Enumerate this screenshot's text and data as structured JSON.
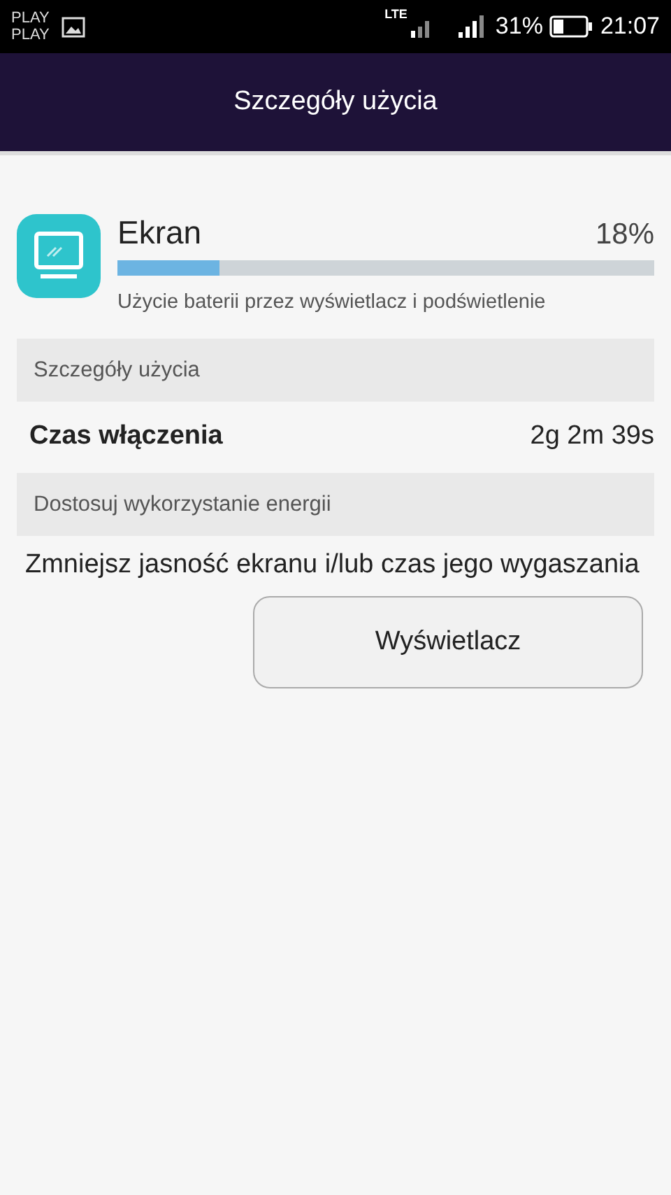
{
  "status_bar": {
    "carriers": [
      "PLAY",
      "PLAY"
    ],
    "network": "LTE",
    "battery": "31%",
    "time": "21:07"
  },
  "title": "Szczegóły użycia",
  "app": {
    "name": "Ekran",
    "percent": "18%",
    "level": 0.19,
    "description": "Użycie baterii przez wyświetlacz i podświetlenie"
  },
  "sections": [
    {
      "header": "Szczegóły użycia",
      "rows": [
        {
          "label": "Czas włączenia",
          "value": "2g 2m 39s"
        }
      ]
    },
    {
      "header": "Dostosuj wykorzystanie energii",
      "text": "Zmniejsz jasność ekranu i/lub czas jego wygaszania",
      "button": "Wyświetlacz"
    }
  ]
}
